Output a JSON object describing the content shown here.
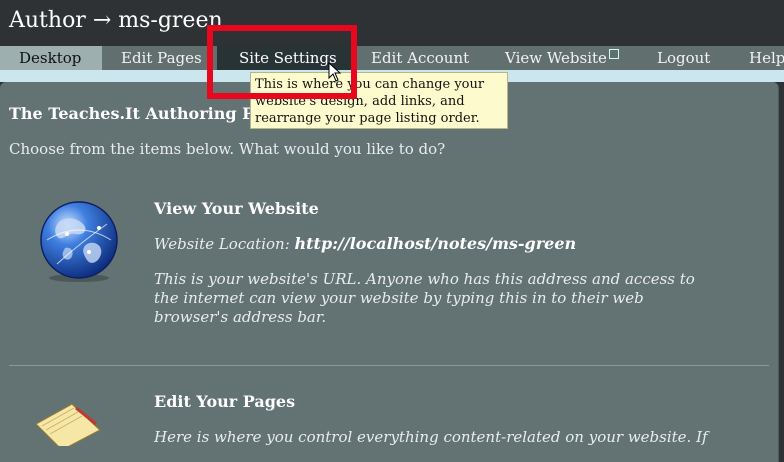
{
  "header": {
    "title": "Author → ms-green"
  },
  "tabs": [
    {
      "label": "Desktop"
    },
    {
      "label": "Edit Pages"
    },
    {
      "label": "Site Settings"
    },
    {
      "label": "Edit Account"
    },
    {
      "label": "View Website"
    },
    {
      "label": "Logout"
    },
    {
      "label": "Help"
    }
  ],
  "tooltip": {
    "line1": "This is where you can change your",
    "line2": "website's design, add links, and",
    "line3": "rearrange your page listing order."
  },
  "panel": {
    "title": "The Teaches.It Authoring Panel",
    "intro": "Choose from the items below. What would you like to do?",
    "view_section": {
      "title": "View Your Website",
      "location_label": "Website Location:",
      "location_url": "http://localhost/notes/ms-green",
      "desc": "This is your website's URL. Anyone who has this address and access to the internet can view your website by typing this in to their web browser's address bar."
    },
    "edit_section": {
      "title": "Edit Your Pages",
      "desc": "Here is where you control everything content-related on your website. If"
    }
  },
  "colors": {
    "highlight": "#e8071c",
    "panel": "#637273",
    "tab_active": "#9dafae",
    "tooltip": "#fdfbcd"
  },
  "icons": [
    "globe-icon",
    "notepad-icon",
    "external-link-icon",
    "cursor-icon"
  ]
}
